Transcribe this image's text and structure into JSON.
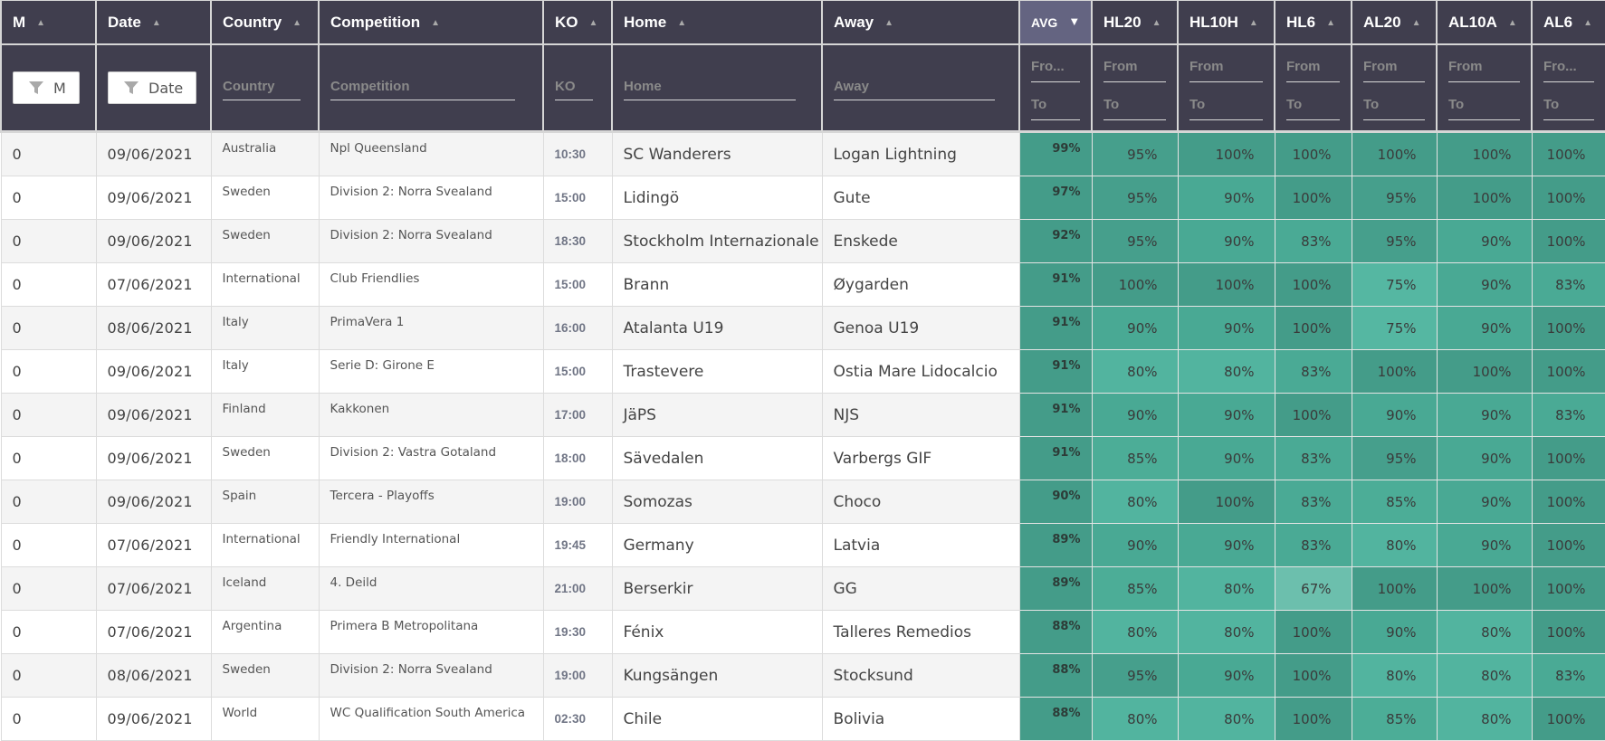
{
  "columns": [
    {
      "key": "m",
      "label": "M",
      "filter_type": "button",
      "filter_label": "M",
      "sort": "asc"
    },
    {
      "key": "date",
      "label": "Date",
      "filter_type": "button",
      "filter_label": "Date",
      "sort": "asc"
    },
    {
      "key": "country",
      "label": "Country",
      "filter_type": "text",
      "placeholder": "Country",
      "sort": "asc"
    },
    {
      "key": "competition",
      "label": "Competition",
      "filter_type": "text",
      "placeholder": "Competition",
      "sort": "asc"
    },
    {
      "key": "ko",
      "label": "KO",
      "filter_type": "text",
      "placeholder": "KO",
      "sort": "asc"
    },
    {
      "key": "home",
      "label": "Home",
      "filter_type": "text",
      "placeholder": "Home",
      "sort": "asc"
    },
    {
      "key": "away",
      "label": "Away",
      "filter_type": "text",
      "placeholder": "Away",
      "sort": "asc"
    },
    {
      "key": "avg",
      "label": "AVG",
      "filter_type": "range",
      "from_placeholder": "Fro...",
      "to_placeholder": "To",
      "sort": "desc",
      "active": true
    },
    {
      "key": "hl20",
      "label": "HL20",
      "filter_type": "range",
      "from_placeholder": "From",
      "to_placeholder": "To",
      "sort": "asc"
    },
    {
      "key": "hl10h",
      "label": "HL10H",
      "filter_type": "range",
      "from_placeholder": "From",
      "to_placeholder": "To",
      "sort": "asc"
    },
    {
      "key": "hl6",
      "label": "HL6",
      "filter_type": "range",
      "from_placeholder": "From",
      "to_placeholder": "To",
      "sort": "asc"
    },
    {
      "key": "al20",
      "label": "AL20",
      "filter_type": "range",
      "from_placeholder": "From",
      "to_placeholder": "To",
      "sort": "asc"
    },
    {
      "key": "al10a",
      "label": "AL10A",
      "filter_type": "range",
      "from_placeholder": "From",
      "to_placeholder": "To",
      "sort": "asc"
    },
    {
      "key": "al6",
      "label": "AL6",
      "filter_type": "range",
      "from_placeholder": "Fro...",
      "to_placeholder": "To",
      "sort": "asc"
    }
  ],
  "icons": {
    "sort_asc": "triangle-up-icon",
    "sort_desc": "triangle-down-icon",
    "filter": "funnel-icon"
  },
  "colors": {
    "header_bg": "#403e4e",
    "active_header_bg": "#646481",
    "pct_100": "#449c89",
    "pct_95": "#469f8c",
    "pct_90": "#49a994",
    "pct_85": "#4cad97",
    "pct_83": "#4aaa95",
    "pct_80": "#52b49f",
    "pct_75": "#55b7a2",
    "pct_67": "#6cbfad",
    "avg_bg": "#449c89"
  },
  "rows": [
    {
      "m": "0",
      "date": "09/06/2021",
      "country": "Australia",
      "competition": "Npl Queensland",
      "ko": "10:30",
      "home": "SC Wanderers",
      "away": "Logan Lightning",
      "avg": "99%",
      "hl20": "95%",
      "hl10h": "100%",
      "hl6": "100%",
      "al20": "100%",
      "al10a": "100%",
      "al6": "100%"
    },
    {
      "m": "0",
      "date": "09/06/2021",
      "country": "Sweden",
      "competition": "Division 2: Norra Svealand",
      "ko": "15:00",
      "home": "Lidingö",
      "away": "Gute",
      "avg": "97%",
      "hl20": "95%",
      "hl10h": "90%",
      "hl6": "100%",
      "al20": "95%",
      "al10a": "100%",
      "al6": "100%"
    },
    {
      "m": "0",
      "date": "09/06/2021",
      "country": "Sweden",
      "competition": "Division 2: Norra Svealand",
      "ko": "18:30",
      "home": "Stockholm Internazionale",
      "away": "Enskede",
      "avg": "92%",
      "hl20": "95%",
      "hl10h": "90%",
      "hl6": "83%",
      "al20": "95%",
      "al10a": "90%",
      "al6": "100%"
    },
    {
      "m": "0",
      "date": "07/06/2021",
      "country": "International",
      "competition": "Club Friendlies",
      "ko": "15:00",
      "home": "Brann",
      "away": "Øygarden",
      "avg": "91%",
      "hl20": "100%",
      "hl10h": "100%",
      "hl6": "100%",
      "al20": "75%",
      "al10a": "90%",
      "al6": "83%"
    },
    {
      "m": "0",
      "date": "08/06/2021",
      "country": "Italy",
      "competition": "PrimaVera 1",
      "ko": "16:00",
      "home": "Atalanta U19",
      "away": "Genoa U19",
      "avg": "91%",
      "hl20": "90%",
      "hl10h": "90%",
      "hl6": "100%",
      "al20": "75%",
      "al10a": "90%",
      "al6": "100%"
    },
    {
      "m": "0",
      "date": "09/06/2021",
      "country": "Italy",
      "competition": "Serie D: Girone E",
      "ko": "15:00",
      "home": "Trastevere",
      "away": "Ostia Mare Lidocalcio",
      "avg": "91%",
      "hl20": "80%",
      "hl10h": "80%",
      "hl6": "83%",
      "al20": "100%",
      "al10a": "100%",
      "al6": "100%"
    },
    {
      "m": "0",
      "date": "09/06/2021",
      "country": "Finland",
      "competition": "Kakkonen",
      "ko": "17:00",
      "home": "JäPS",
      "away": "NJS",
      "avg": "91%",
      "hl20": "90%",
      "hl10h": "90%",
      "hl6": "100%",
      "al20": "90%",
      "al10a": "90%",
      "al6": "83%"
    },
    {
      "m": "0",
      "date": "09/06/2021",
      "country": "Sweden",
      "competition": "Division 2: Vastra Gotaland",
      "ko": "18:00",
      "home": "Sävedalen",
      "away": "Varbergs GIF",
      "avg": "91%",
      "hl20": "85%",
      "hl10h": "90%",
      "hl6": "83%",
      "al20": "95%",
      "al10a": "90%",
      "al6": "100%"
    },
    {
      "m": "0",
      "date": "09/06/2021",
      "country": "Spain",
      "competition": "Tercera - Playoffs",
      "ko": "19:00",
      "home": "Somozas",
      "away": "Choco",
      "avg": "90%",
      "hl20": "80%",
      "hl10h": "100%",
      "hl6": "83%",
      "al20": "85%",
      "al10a": "90%",
      "al6": "100%"
    },
    {
      "m": "0",
      "date": "07/06/2021",
      "country": "International",
      "competition": "Friendly International",
      "ko": "19:45",
      "home": "Germany",
      "away": "Latvia",
      "avg": "89%",
      "hl20": "90%",
      "hl10h": "90%",
      "hl6": "83%",
      "al20": "80%",
      "al10a": "90%",
      "al6": "100%"
    },
    {
      "m": "0",
      "date": "07/06/2021",
      "country": "Iceland",
      "competition": "4. Deild",
      "ko": "21:00",
      "home": "Berserkir",
      "away": "GG",
      "avg": "89%",
      "hl20": "85%",
      "hl10h": "80%",
      "hl6": "67%",
      "al20": "100%",
      "al10a": "100%",
      "al6": "100%"
    },
    {
      "m": "0",
      "date": "07/06/2021",
      "country": "Argentina",
      "competition": "Primera B Metropolitana",
      "ko": "19:30",
      "home": "Fénix",
      "away": "Talleres Remedios",
      "avg": "88%",
      "hl20": "80%",
      "hl10h": "80%",
      "hl6": "100%",
      "al20": "90%",
      "al10a": "80%",
      "al6": "100%"
    },
    {
      "m": "0",
      "date": "08/06/2021",
      "country": "Sweden",
      "competition": "Division 2: Norra Svealand",
      "ko": "19:00",
      "home": "Kungsängen",
      "away": "Stocksund",
      "avg": "88%",
      "hl20": "95%",
      "hl10h": "90%",
      "hl6": "100%",
      "al20": "80%",
      "al10a": "80%",
      "al6": "83%"
    },
    {
      "m": "0",
      "date": "09/06/2021",
      "country": "World",
      "competition": "WC Qualification South America",
      "ko": "02:30",
      "home": "Chile",
      "away": "Bolivia",
      "avg": "88%",
      "hl20": "80%",
      "hl10h": "80%",
      "hl6": "100%",
      "al20": "85%",
      "al10a": "80%",
      "al6": "100%"
    }
  ]
}
